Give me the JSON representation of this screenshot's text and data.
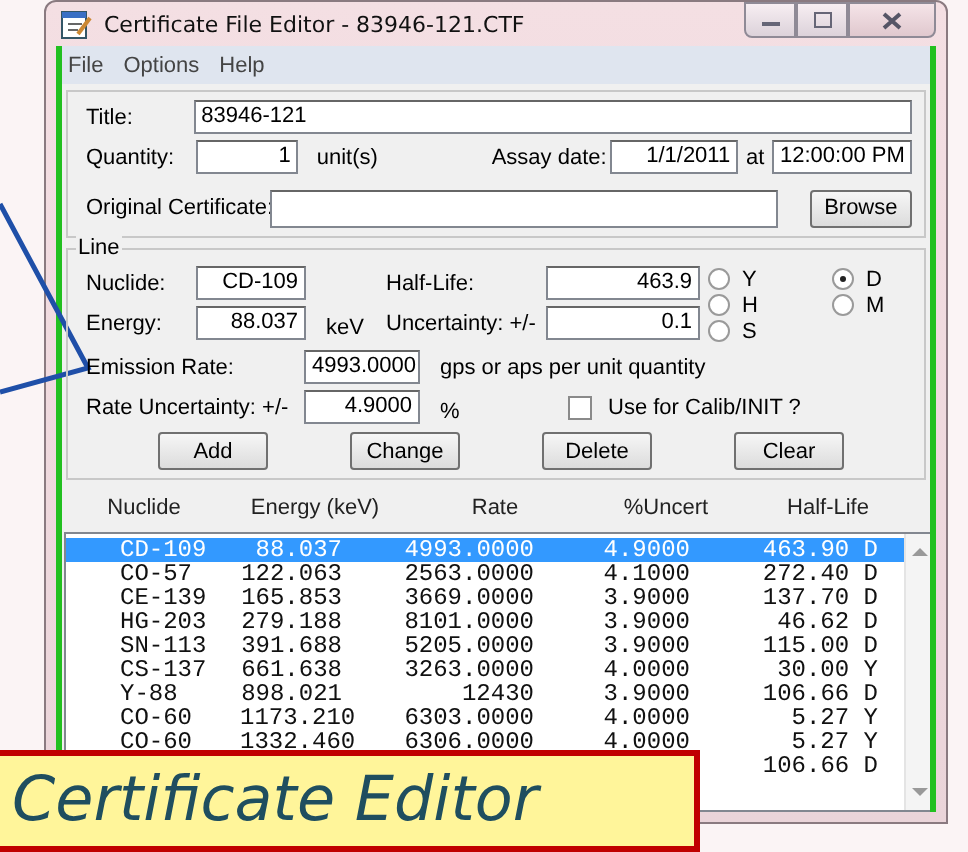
{
  "window": {
    "title": "Certificate File Editor - 83946-121.CTF"
  },
  "menu": [
    "File",
    "Options",
    "Help"
  ],
  "header": {
    "title": {
      "label": "Title:",
      "value": "83946-121"
    },
    "quantity": {
      "label": "Quantity:",
      "value": "1",
      "unit": "unit(s)"
    },
    "assay_date": {
      "label": "Assay date:",
      "value": "1/1/2011",
      "joiner": "at",
      "time": "12:00:00 PM"
    },
    "original_certificate": {
      "label": "Original Certificate:"
    },
    "browse_button": "Browse"
  },
  "line": {
    "legend": "Line",
    "nuclide": {
      "label": "Nuclide:",
      "value": "CD-109"
    },
    "energy": {
      "label": "Energy:",
      "value": "88.037",
      "unit": "keV"
    },
    "half_life": {
      "label": "Half-Life:",
      "value": "463.9"
    },
    "uncertainty": {
      "label": "Uncertainty: +/-",
      "value": "0.1"
    },
    "half_life_units": [
      {
        "label": "Y",
        "selected": false
      },
      {
        "label": "D",
        "selected": true
      },
      {
        "label": "H",
        "selected": false
      },
      {
        "label": "M",
        "selected": false
      },
      {
        "label": "S",
        "selected": false
      }
    ],
    "emission_rate": {
      "label": "Emission Rate:",
      "value": "4993.0000",
      "unit": "gps or aps per unit quantity"
    },
    "rate_uncertainty": {
      "label": "Rate Uncertainty: +/-",
      "value": "4.9000",
      "unit": "%"
    },
    "calib": {
      "label": "Use for Calib/INIT ?",
      "checked": false
    },
    "buttons": [
      "Add",
      "Change",
      "Delete",
      "Clear"
    ]
  },
  "table": {
    "columns": [
      "Nuclide",
      "Energy (keV)",
      "Rate",
      "%Uncert",
      "Half-Life"
    ],
    "rows": [
      {
        "nuclide": "CD-109",
        "energy": "88.037",
        "rate": "4993.0000",
        "uncert": "4.9000",
        "half_life": "463.90 D",
        "selected": true
      },
      {
        "nuclide": "CO-57",
        "energy": "122.063",
        "rate": "2563.0000",
        "uncert": "4.1000",
        "half_life": "272.40 D",
        "selected": false
      },
      {
        "nuclide": "CE-139",
        "energy": "165.853",
        "rate": "3669.0000",
        "uncert": "3.9000",
        "half_life": "137.70 D",
        "selected": false
      },
      {
        "nuclide": "HG-203",
        "energy": "279.188",
        "rate": "8101.0000",
        "uncert": "3.9000",
        "half_life": "46.62 D",
        "selected": false
      },
      {
        "nuclide": "SN-113",
        "energy": "391.688",
        "rate": "5205.0000",
        "uncert": "3.9000",
        "half_life": "115.00 D",
        "selected": false
      },
      {
        "nuclide": "CS-137",
        "energy": "661.638",
        "rate": "3263.0000",
        "uncert": "4.0000",
        "half_life": "30.00 Y",
        "selected": false
      },
      {
        "nuclide": "Y-88",
        "energy": "898.021",
        "rate": "12430",
        "uncert": "3.9000",
        "half_life": "106.66 D",
        "selected": false
      },
      {
        "nuclide": "CO-60",
        "energy": "1173.210",
        "rate": "6303.0000",
        "uncert": "4.0000",
        "half_life": "5.27 Y",
        "selected": false
      },
      {
        "nuclide": "CO-60",
        "energy": "1332.460",
        "rate": "6306.0000",
        "uncert": "4.0000",
        "half_life": "5.27 Y",
        "selected": false
      },
      {
        "half_life": "106.66 D",
        "selected": false
      }
    ]
  },
  "callout": {
    "text": "Certificate Editor"
  }
}
